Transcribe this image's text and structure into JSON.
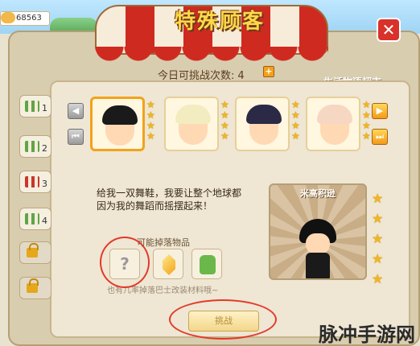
{
  "coin_value": "68563",
  "title": "特殊顾客",
  "challenge": {
    "label": "今日可挑战次数:",
    "count": "4",
    "plus": "+"
  },
  "shop_name": "生活物语超市",
  "close_symbol": "✕",
  "tabs": [
    {
      "label": "1",
      "locked": false
    },
    {
      "label": "2",
      "locked": false
    },
    {
      "label": "3",
      "locked": false,
      "selected": true
    },
    {
      "label": "4",
      "locked": false
    },
    {
      "label": "",
      "locked": true
    },
    {
      "label": "",
      "locked": true
    }
  ],
  "nav": {
    "prev": "◀",
    "first": "⏮",
    "next": "▶",
    "last": "⏭"
  },
  "customers": [
    {
      "name": "customer-1",
      "stars": 4,
      "selected": true
    },
    {
      "name": "customer-2",
      "stars": 4
    },
    {
      "name": "customer-3",
      "stars": 4
    },
    {
      "name": "customer-4",
      "stars": 4
    }
  ],
  "dialog_text": "给我一双舞鞋，我要让整个地球都因为我的舞蹈而摇摆起来！",
  "drops": {
    "label": "可能掉落物品",
    "unknown_symbol": "?",
    "description": "也有几率掉落巴士改装材料哦~"
  },
  "card": {
    "title": "米高积逊",
    "stars": 5
  },
  "challenge_button": "挑战",
  "watermark": "脉冲手游网",
  "colors": {
    "accent_orange": "#f2a21a",
    "awning_red": "#cf2a20",
    "annotation_red": "#e23a2a"
  }
}
